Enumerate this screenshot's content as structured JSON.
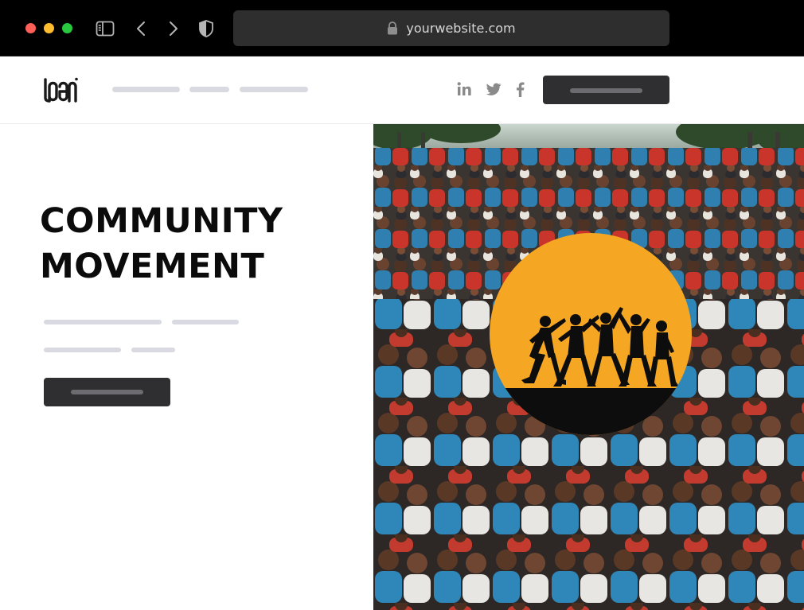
{
  "browser": {
    "url": "yourwebsite.com",
    "icons": [
      "sidebar-icon",
      "chevron-left-icon",
      "chevron-right-icon",
      "shield-icon",
      "lock-icon"
    ]
  },
  "header": {
    "logo_text": "LOGO",
    "social": [
      "linkedin-icon",
      "twitter-icon",
      "facebook-icon"
    ]
  },
  "hero": {
    "title_line_1": "COMMUNITY",
    "title_line_2": "MOVEMENT"
  },
  "colors": {
    "accent": "#f5a623",
    "button_dark": "#2f2f31",
    "placeholder_line": "#d9d9e1"
  }
}
